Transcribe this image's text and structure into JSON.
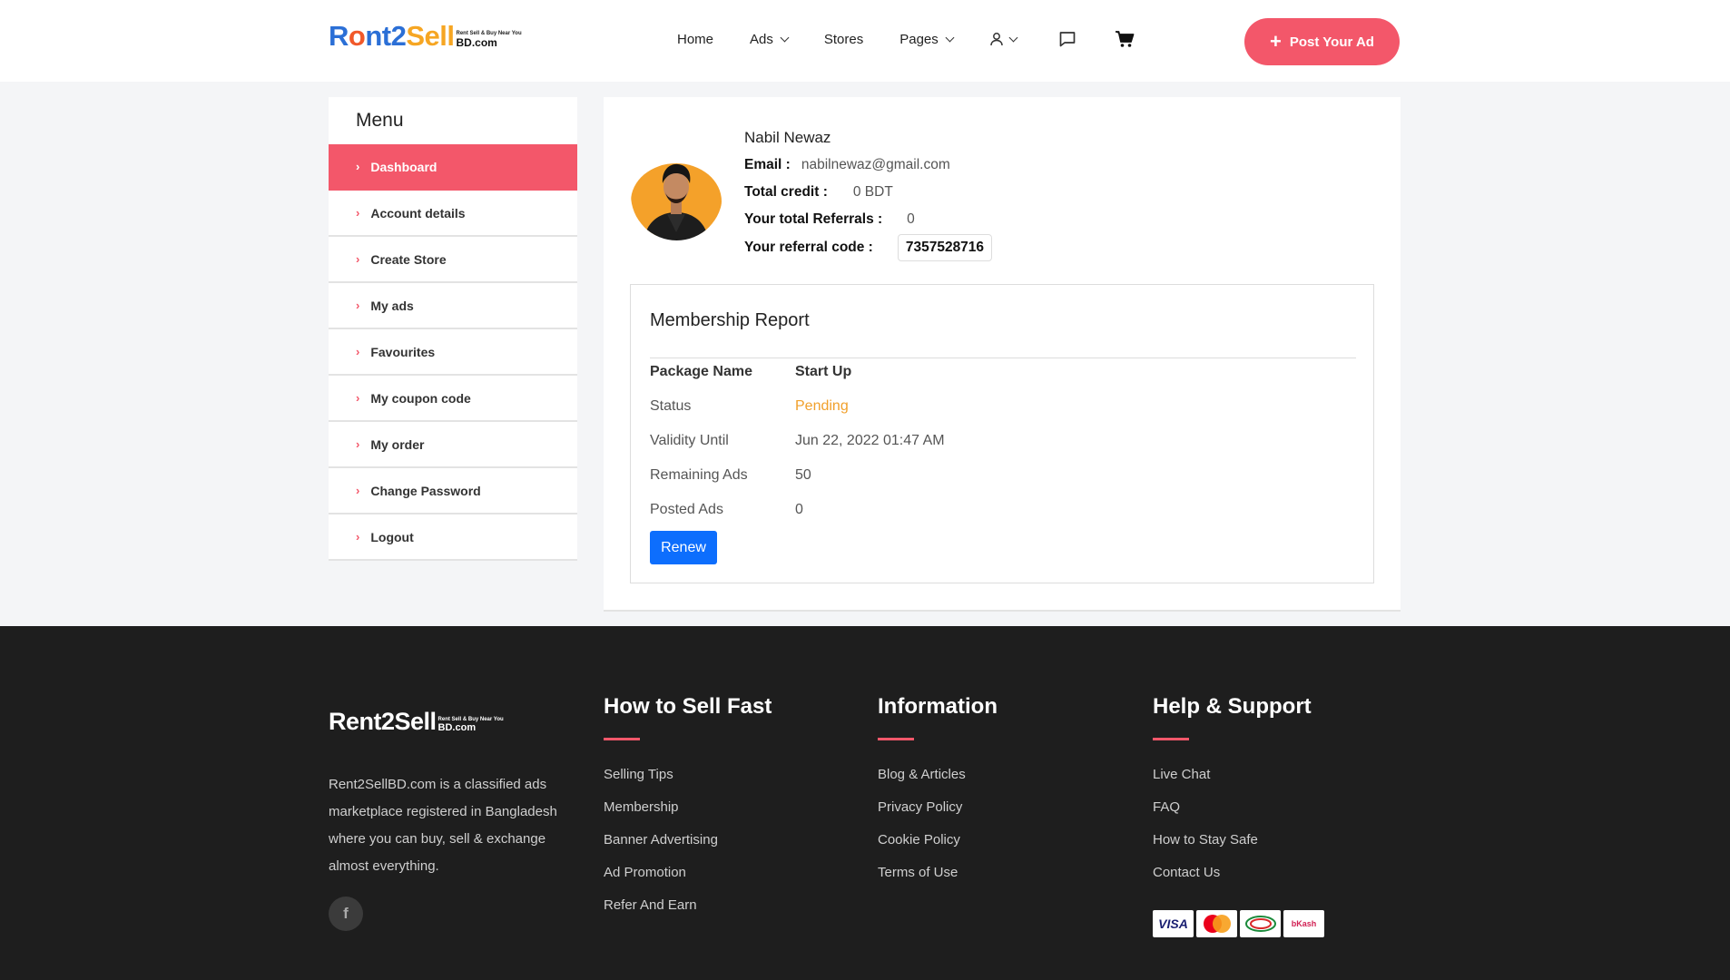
{
  "header": {
    "logo": {
      "r": "R",
      "o": "o",
      "nt2": "nt2",
      "sell": "Sell",
      "tagline": "Rent Sell & Buy Near You",
      "bd": "BD.com"
    },
    "nav": {
      "home": "Home",
      "ads": "Ads",
      "stores": "Stores",
      "pages": "Pages"
    },
    "post_button": "Post Your Ad"
  },
  "sidebar": {
    "title": "Menu",
    "items": [
      {
        "label": "Dashboard"
      },
      {
        "label": "Account details"
      },
      {
        "label": "Create Store"
      },
      {
        "label": "My ads"
      },
      {
        "label": "Favourites"
      },
      {
        "label": "My coupon code"
      },
      {
        "label": "My order"
      },
      {
        "label": "Change Password"
      },
      {
        "label": "Logout"
      }
    ]
  },
  "profile": {
    "name": "Nabil Newaz",
    "email_label": "Email :",
    "email": "nabilnewaz@gmail.com",
    "credit_label": "Total credit :",
    "credit": "0 BDT",
    "referrals_label": "Your total Referrals :",
    "referrals": "0",
    "refcode_label": "Your referral code :",
    "refcode": "7357528716"
  },
  "membership": {
    "title": "Membership Report",
    "rows": [
      {
        "key": "Package Name",
        "value": "Start Up"
      },
      {
        "key": "Status",
        "value": "Pending"
      },
      {
        "key": "Validity Until",
        "value": "Jun 22, 2022 01:47 AM"
      },
      {
        "key": "Remaining Ads",
        "value": "50"
      },
      {
        "key": "Posted Ads",
        "value": "0"
      }
    ],
    "renew_label": "Renew",
    "pending_color": "#f1a02b"
  },
  "footer": {
    "logo": {
      "main": "Rent2Sell",
      "tagline": "Rent Sell & Buy Near You",
      "bd": "BD.com"
    },
    "about": "Rent2SellBD.com is a classified ads marketplace registered in Bangladesh where you can buy, sell & exchange almost everything.",
    "facebook": "f",
    "columns": [
      {
        "title": "How to Sell Fast",
        "links": [
          "Selling Tips",
          "Membership",
          "Banner Advertising",
          "Ad Promotion",
          "Refer And Earn"
        ]
      },
      {
        "title": "Information",
        "links": [
          "Blog & Articles",
          "Privacy Policy",
          "Cookie Policy",
          "Terms of Use"
        ]
      },
      {
        "title": "Help & Support",
        "links": [
          "Live Chat",
          "FAQ",
          "How to Stay Safe",
          "Contact Us"
        ]
      }
    ],
    "payments": [
      "VISA",
      "MasterCard",
      "bKash"
    ]
  },
  "colors": {
    "accent": "#f3576a",
    "primary_button": "#0d6efd",
    "footer_bg": "#1e1e1e"
  }
}
